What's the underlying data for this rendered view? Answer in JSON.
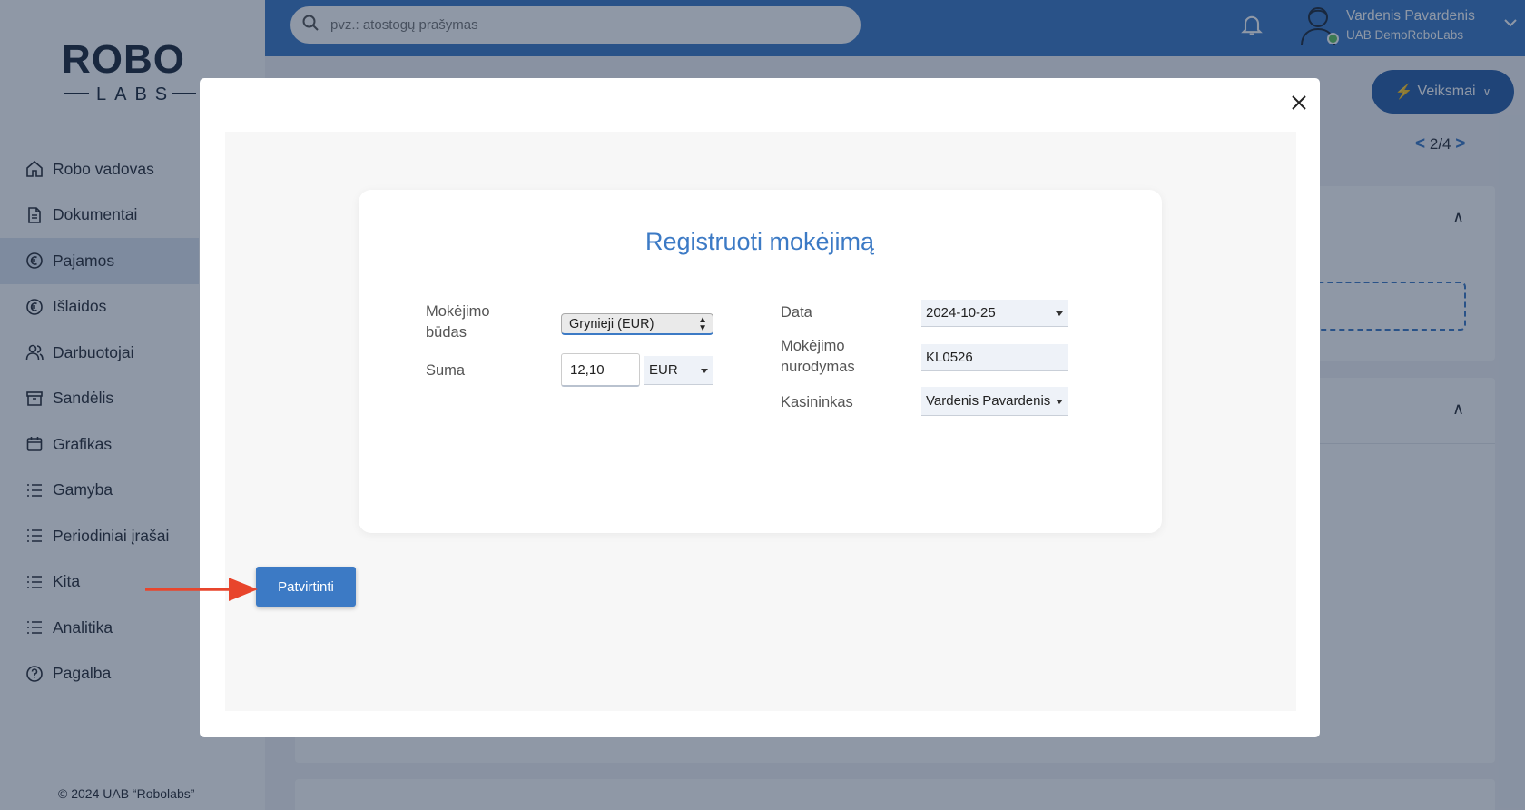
{
  "app": {
    "logo_text_top": "ROBO",
    "logo_text_bottom": "LABS",
    "copyright": "© 2024 UAB “Robolabs”"
  },
  "sidebar": {
    "items": [
      {
        "label": "Robo vadovas",
        "icon": "home-icon"
      },
      {
        "label": "Dokumentai",
        "icon": "document-icon"
      },
      {
        "label": "Pajamos",
        "icon": "income-icon",
        "active": true
      },
      {
        "label": "Išlaidos",
        "icon": "expense-icon"
      },
      {
        "label": "Darbuotojai",
        "icon": "users-icon"
      },
      {
        "label": "Sandėlis",
        "icon": "archive-icon"
      },
      {
        "label": "Grafikas",
        "icon": "calendar-icon"
      },
      {
        "label": "Gamyba",
        "icon": "list-icon"
      },
      {
        "label": "Periodiniai įrašai",
        "icon": "list-icon"
      },
      {
        "label": "Kita",
        "icon": "list-icon"
      },
      {
        "label": "Analitika",
        "icon": "list-icon"
      },
      {
        "label": "Pagalba",
        "icon": "help-icon"
      }
    ]
  },
  "header": {
    "search_placeholder": "pvz.: atostogų prašymas",
    "user_name": "Vardenis Pavardenis",
    "user_company": "UAB DemoRoboLabs"
  },
  "page": {
    "actions_label": "Veiksmai",
    "pager_current": "2",
    "pager_separator": "/",
    "pager_total": "4",
    "pager_prev": "<",
    "pager_next": ">"
  },
  "modal": {
    "title": "Registruoti mokėjimą",
    "payment_method_label": "Mokėjimo būdas",
    "payment_method_value": "Grynieji (EUR)",
    "amount_label": "Suma",
    "amount_value": "12,10",
    "currency_value": "EUR",
    "date_label": "Data",
    "date_value": "2024-10-25",
    "reference_label": "Mokėjimo nurodymas",
    "reference_value": "KL0526",
    "cashier_label": "Kasininkas",
    "cashier_value": "Vardenis Pavardenis",
    "confirm_label": "Patvirtinti"
  },
  "colors": {
    "accent": "#3c7ac5",
    "annotation_arrow": "#e8452c"
  }
}
